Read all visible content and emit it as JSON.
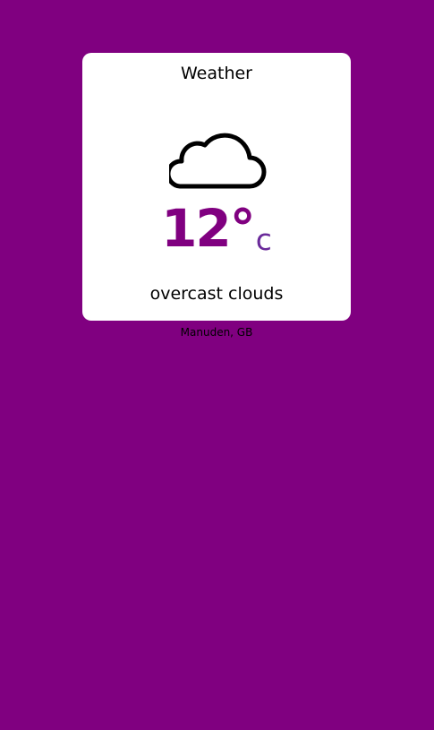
{
  "widget": {
    "title": "Weather",
    "icon": "cloud-icon",
    "temperature": "12°",
    "unit": "c",
    "description": "overcast clouds",
    "location": "Manuden, GB"
  },
  "colors": {
    "background": "#800080",
    "card": "#ffffff",
    "temperature": "#800080",
    "unit": "#6a2a9a"
  }
}
